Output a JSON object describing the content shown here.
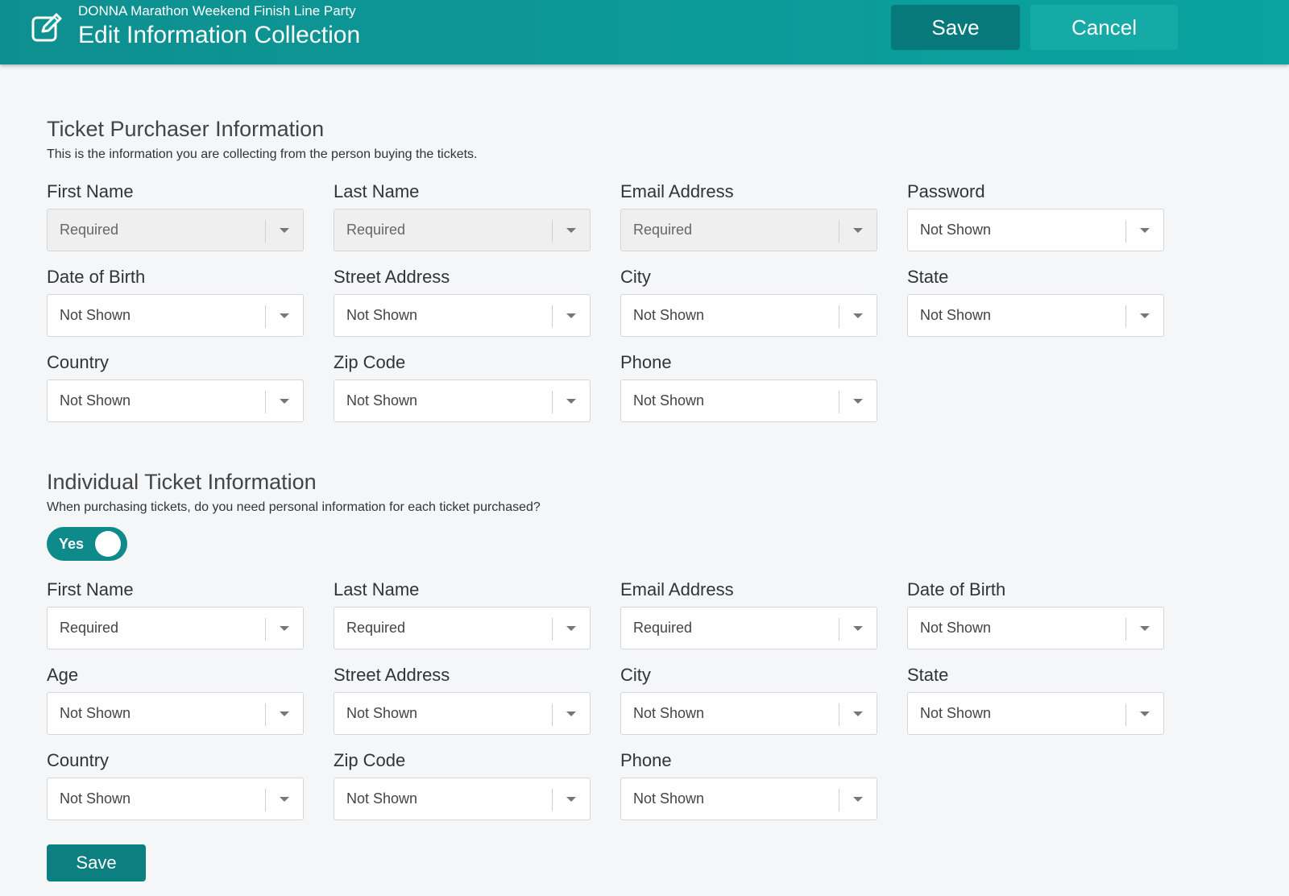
{
  "header": {
    "event_name": "DONNA Marathon Weekend Finish Line Party",
    "title": "Edit Information Collection",
    "save_label": "Save",
    "cancel_label": "Cancel"
  },
  "colors": {
    "header_teal": "#0aa3a0",
    "save_button": "#07797b",
    "toggle_on": "#0e8a8a"
  },
  "purchaser": {
    "title": "Ticket Purchaser Information",
    "description": "This is the information you are collecting from the person buying the tickets.",
    "fields": [
      {
        "label": "First Name",
        "value": "Required",
        "disabled": true
      },
      {
        "label": "Last Name",
        "value": "Required",
        "disabled": true
      },
      {
        "label": "Email Address",
        "value": "Required",
        "disabled": true
      },
      {
        "label": "Password",
        "value": "Not Shown",
        "disabled": false
      },
      {
        "label": "Date of Birth",
        "value": "Not Shown",
        "disabled": false
      },
      {
        "label": "Street Address",
        "value": "Not Shown",
        "disabled": false
      },
      {
        "label": "City",
        "value": "Not Shown",
        "disabled": false
      },
      {
        "label": "State",
        "value": "Not Shown",
        "disabled": false
      },
      {
        "label": "Country",
        "value": "Not Shown",
        "disabled": false
      },
      {
        "label": "Zip Code",
        "value": "Not Shown",
        "disabled": false
      },
      {
        "label": "Phone",
        "value": "Not Shown",
        "disabled": false
      }
    ]
  },
  "individual": {
    "title": "Individual Ticket Information",
    "description": "When purchasing tickets, do you need personal information for each ticket purchased?",
    "toggle_label": "Yes",
    "toggle_on": true,
    "fields": [
      {
        "label": "First Name",
        "value": "Required",
        "disabled": false
      },
      {
        "label": "Last Name",
        "value": "Required",
        "disabled": false
      },
      {
        "label": "Email Address",
        "value": "Required",
        "disabled": false
      },
      {
        "label": "Date of Birth",
        "value": "Not Shown",
        "disabled": false
      },
      {
        "label": "Age",
        "value": "Not Shown",
        "disabled": false
      },
      {
        "label": "Street Address",
        "value": "Not Shown",
        "disabled": false
      },
      {
        "label": "City",
        "value": "Not Shown",
        "disabled": false
      },
      {
        "label": "State",
        "value": "Not Shown",
        "disabled": false
      },
      {
        "label": "Country",
        "value": "Not Shown",
        "disabled": false
      },
      {
        "label": "Zip Code",
        "value": "Not Shown",
        "disabled": false
      },
      {
        "label": "Phone",
        "value": "Not Shown",
        "disabled": false
      }
    ],
    "save_label": "Save"
  }
}
